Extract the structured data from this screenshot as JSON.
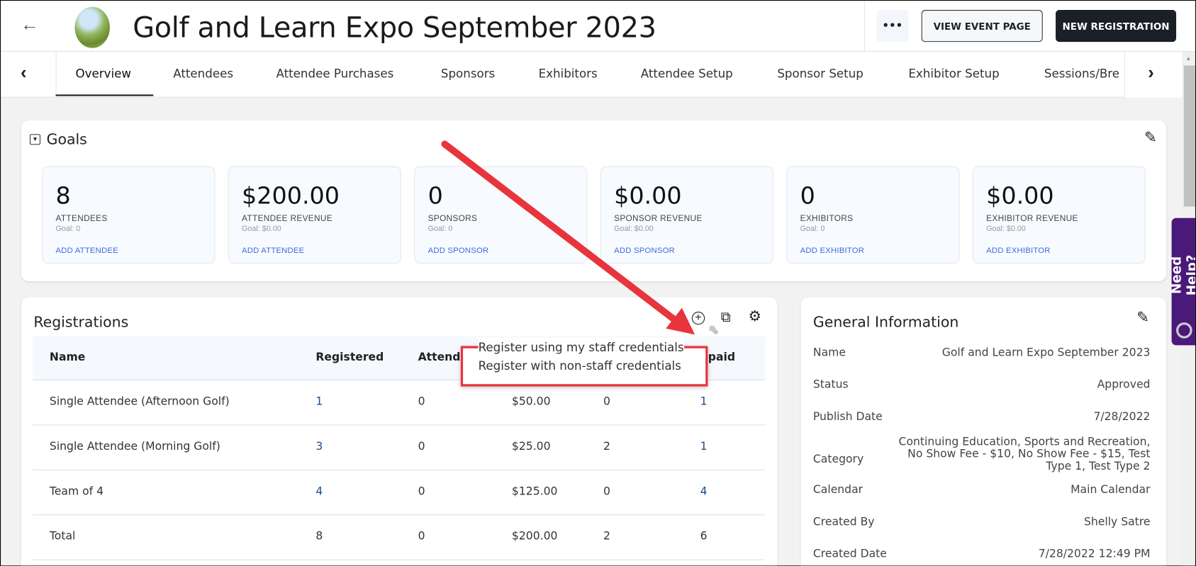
{
  "header": {
    "title": "Golf and Learn Expo September 2023",
    "more_label": "•••",
    "view_event_label": "VIEW EVENT PAGE",
    "new_registration_label": "NEW REGISTRATION"
  },
  "tabs": [
    "Overview",
    "Attendees",
    "Attendee Purchases",
    "Sponsors",
    "Exhibitors",
    "Attendee Setup",
    "Sponsor Setup",
    "Exhibitor Setup",
    "Sessions/Bre"
  ],
  "active_tab": "Overview",
  "goals": {
    "title": "Goals",
    "cards": [
      {
        "value": "8",
        "label": "ATTENDEES",
        "goal": "Goal: 0",
        "link": "ADD ATTENDEE"
      },
      {
        "value": "$200.00",
        "label": "ATTENDEE REVENUE",
        "goal": "Goal: $0.00",
        "link": "ADD ATTENDEE"
      },
      {
        "value": "0",
        "label": "SPONSORS",
        "goal": "Goal: 0",
        "link": "ADD SPONSOR"
      },
      {
        "value": "$0.00",
        "label": "SPONSOR REVENUE",
        "goal": "Goal: $0.00",
        "link": "ADD SPONSOR"
      },
      {
        "value": "0",
        "label": "EXHIBITORS",
        "goal": "Goal: 0",
        "link": "ADD EXHIBITOR"
      },
      {
        "value": "$0.00",
        "label": "EXHIBITOR REVENUE",
        "goal": "Goal: $0.00",
        "link": "ADD EXHIBITOR"
      }
    ]
  },
  "registrations": {
    "title": "Registrations",
    "columns": [
      "Name",
      "Registered",
      "Attende",
      "",
      "",
      "npaid"
    ],
    "rows": [
      [
        "Single Attendee (Afternoon Golf)",
        "1",
        "0",
        "$50.00",
        "0",
        "1"
      ],
      [
        "Single Attendee (Morning Golf)",
        "3",
        "0",
        "$25.00",
        "2",
        "1"
      ],
      [
        "Team of 4",
        "4",
        "0",
        "$125.00",
        "0",
        "4"
      ],
      [
        "Total",
        "8",
        "0",
        "$200.00",
        "2",
        "6"
      ]
    ],
    "menu": [
      "Register using my staff credentials",
      "Register with non-staff credentials"
    ]
  },
  "general_info": {
    "title": "General Information",
    "rows": [
      {
        "label": "Name",
        "value": "Golf and Learn Expo September 2023"
      },
      {
        "label": "Status",
        "value": "Approved"
      },
      {
        "label": "Publish Date",
        "value": "7/28/2022"
      },
      {
        "label": "Category",
        "value": "Continuing Education, Sports and Recreation, No Show Fee - $10, No Show Fee - $15, Test Type 1, Test Type 2"
      },
      {
        "label": "Calendar",
        "value": "Main Calendar"
      },
      {
        "label": "Created By",
        "value": "Shelly Satre"
      },
      {
        "label": "Created Date",
        "value": "7/28/2022 12:49 PM"
      }
    ]
  },
  "help": {
    "label": "Need Help?"
  },
  "colors": {
    "accent": "#1b1f27",
    "link": "#3f6ad8",
    "annotation": "#e8343c",
    "help": "#4a1a7a"
  }
}
